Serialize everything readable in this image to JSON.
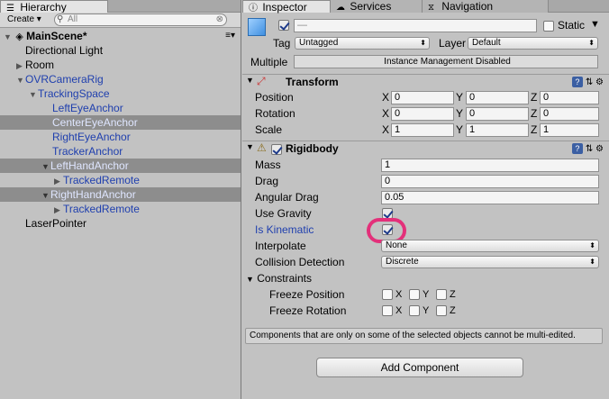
{
  "hierarchy": {
    "tab_label": "Hierarchy",
    "create_label": "Create",
    "search_placeholder": "All",
    "scene_name": "MainScene*",
    "items": [
      {
        "label": "Directional Light"
      },
      {
        "label": "Room"
      },
      {
        "label": "OVRCameraRig"
      },
      {
        "label": "TrackingSpace"
      },
      {
        "label": "LeftEyeAnchor"
      },
      {
        "label": "CenterEyeAnchor"
      },
      {
        "label": "RightEyeAnchor"
      },
      {
        "label": "TrackerAnchor"
      },
      {
        "label": "LeftHandAnchor"
      },
      {
        "label": "TrackedRemote"
      },
      {
        "label": "RightHandAnchor"
      },
      {
        "label": "TrackedRemote"
      },
      {
        "label": "LaserPointer"
      }
    ]
  },
  "inspector": {
    "tabs": [
      {
        "label": "Inspector"
      },
      {
        "label": "Services"
      },
      {
        "label": "Navigation"
      }
    ],
    "name_value": "—",
    "static_label": "Static",
    "tag_label": "Tag",
    "tag_value": "Untagged",
    "layer_label": "Layer",
    "layer_value": "Default",
    "multiple_label": "Multiple",
    "multiple_value": "Instance Management Disabled",
    "transform": {
      "title": "Transform",
      "rows": [
        {
          "label": "Position",
          "x": "0",
          "y": "0",
          "z": "0"
        },
        {
          "label": "Rotation",
          "x": "0",
          "y": "0",
          "z": "0"
        },
        {
          "label": "Scale",
          "x": "1",
          "y": "1",
          "z": "1"
        }
      ],
      "axis_x": "X",
      "axis_y": "Y",
      "axis_z": "Z"
    },
    "rigidbody": {
      "title": "Rigidbody",
      "mass_label": "Mass",
      "mass_value": "1",
      "drag_label": "Drag",
      "drag_value": "0",
      "angular_drag_label": "Angular Drag",
      "angular_drag_value": "0.05",
      "use_gravity_label": "Use Gravity",
      "is_kinematic_label": "Is Kinematic",
      "interpolate_label": "Interpolate",
      "interpolate_value": "None",
      "collision_label": "Collision Detection",
      "collision_value": "Discrete",
      "constraints_label": "Constraints",
      "freeze_position_label": "Freeze Position",
      "freeze_rotation_label": "Freeze Rotation",
      "x": "X",
      "y": "Y",
      "z": "Z"
    },
    "info_text": "Components that are only on some of the selected objects cannot be multi-edited.",
    "add_component_label": "Add Component",
    "help_glyph": "?"
  }
}
